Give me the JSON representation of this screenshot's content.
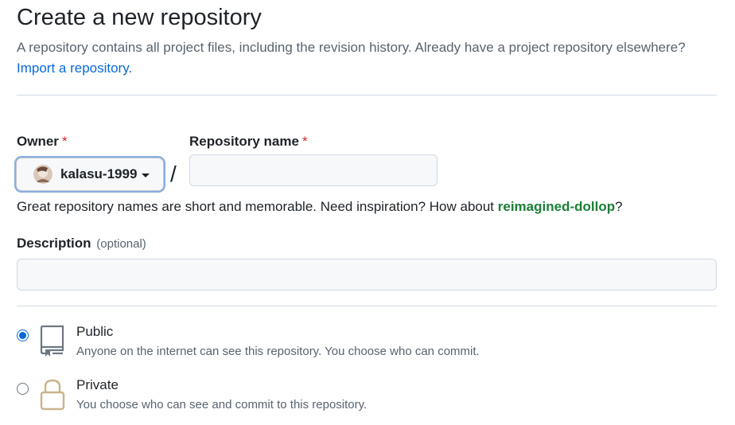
{
  "header": {
    "title": "Create a new repository",
    "subtitle": "A repository contains all project files, including the revision history. Already have a project repository elsewhere?",
    "import_link": "Import a repository."
  },
  "owner": {
    "label": "Owner",
    "required_mark": "*",
    "selected": "kalasu-1999"
  },
  "separator": "/",
  "repo_name": {
    "label": "Repository name",
    "required_mark": "*",
    "value": "",
    "helper_prefix": "Great repository names are short and memorable. Need inspiration? How about",
    "suggestion": "reimagined-dollop",
    "helper_suffix": "?"
  },
  "description": {
    "label": "Description",
    "optional": "(optional)",
    "value": ""
  },
  "visibility": {
    "selected": "public",
    "options": [
      {
        "title": "Public",
        "desc": "Anyone on the internet can see this repository. You choose who can commit.",
        "icon": "repo-icon"
      },
      {
        "title": "Private",
        "desc": "You choose who can see and commit to this repository.",
        "icon": "lock-icon"
      }
    ]
  },
  "colors": {
    "link": "#0969da",
    "required": "#d1242f",
    "suggestion": "#1a7f37",
    "radio_selected": "#0969da",
    "lock_icon": "#c9b48a"
  }
}
